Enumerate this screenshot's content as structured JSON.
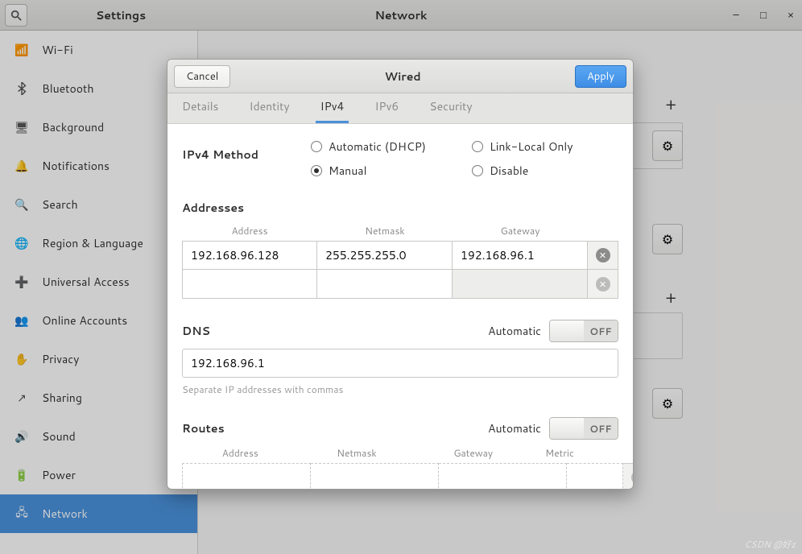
{
  "window": {
    "back_title": "Settings",
    "title": "Network",
    "minimize": "–",
    "maximize": "□",
    "close": "×"
  },
  "sidebar": {
    "items": [
      {
        "icon": "wifi",
        "label": "Wi-Fi"
      },
      {
        "icon": "bluetooth",
        "label": "Bluetooth"
      },
      {
        "icon": "background",
        "label": "Background"
      },
      {
        "icon": "bell",
        "label": "Notifications"
      },
      {
        "icon": "search",
        "label": "Search"
      },
      {
        "icon": "globe",
        "label": "Region & Language"
      },
      {
        "icon": "universal",
        "label": "Universal Access"
      },
      {
        "icon": "accounts",
        "label": "Online Accounts"
      },
      {
        "icon": "privacy",
        "label": "Privacy"
      },
      {
        "icon": "sharing",
        "label": "Sharing"
      },
      {
        "icon": "sound",
        "label": "Sound"
      },
      {
        "icon": "power",
        "label": "Power"
      },
      {
        "icon": "network",
        "label": "Network"
      }
    ],
    "active_index": 12
  },
  "dialog": {
    "cancel": "Cancel",
    "apply": "Apply",
    "title": "Wired",
    "tabs": [
      "Details",
      "Identity",
      "IPv4",
      "IPv6",
      "Security"
    ],
    "active_tab": 2,
    "method_label": "IPv4 Method",
    "methods": {
      "auto": "Automatic (DHCP)",
      "linklocal": "Link-Local Only",
      "manual": "Manual",
      "disable": "Disable",
      "selected": "manual"
    },
    "addresses": {
      "title": "Addresses",
      "cols": {
        "address": "Address",
        "netmask": "Netmask",
        "gateway": "Gateway"
      },
      "rows": [
        {
          "address": "192.168.96.128",
          "netmask": "255.255.255.0",
          "gateway": "192.168.96.1"
        },
        {
          "address": "",
          "netmask": "",
          "gateway": ""
        }
      ]
    },
    "dns": {
      "title": "DNS",
      "auto_label": "Automatic",
      "switch": "OFF",
      "value": "192.168.96.1",
      "hint": "Separate IP addresses with commas"
    },
    "routes": {
      "title": "Routes",
      "auto_label": "Automatic",
      "switch": "OFF",
      "cols": {
        "address": "Address",
        "netmask": "Netmask",
        "gateway": "Gateway",
        "metric": "Metric"
      }
    }
  },
  "watermark": "CSDN @好z"
}
